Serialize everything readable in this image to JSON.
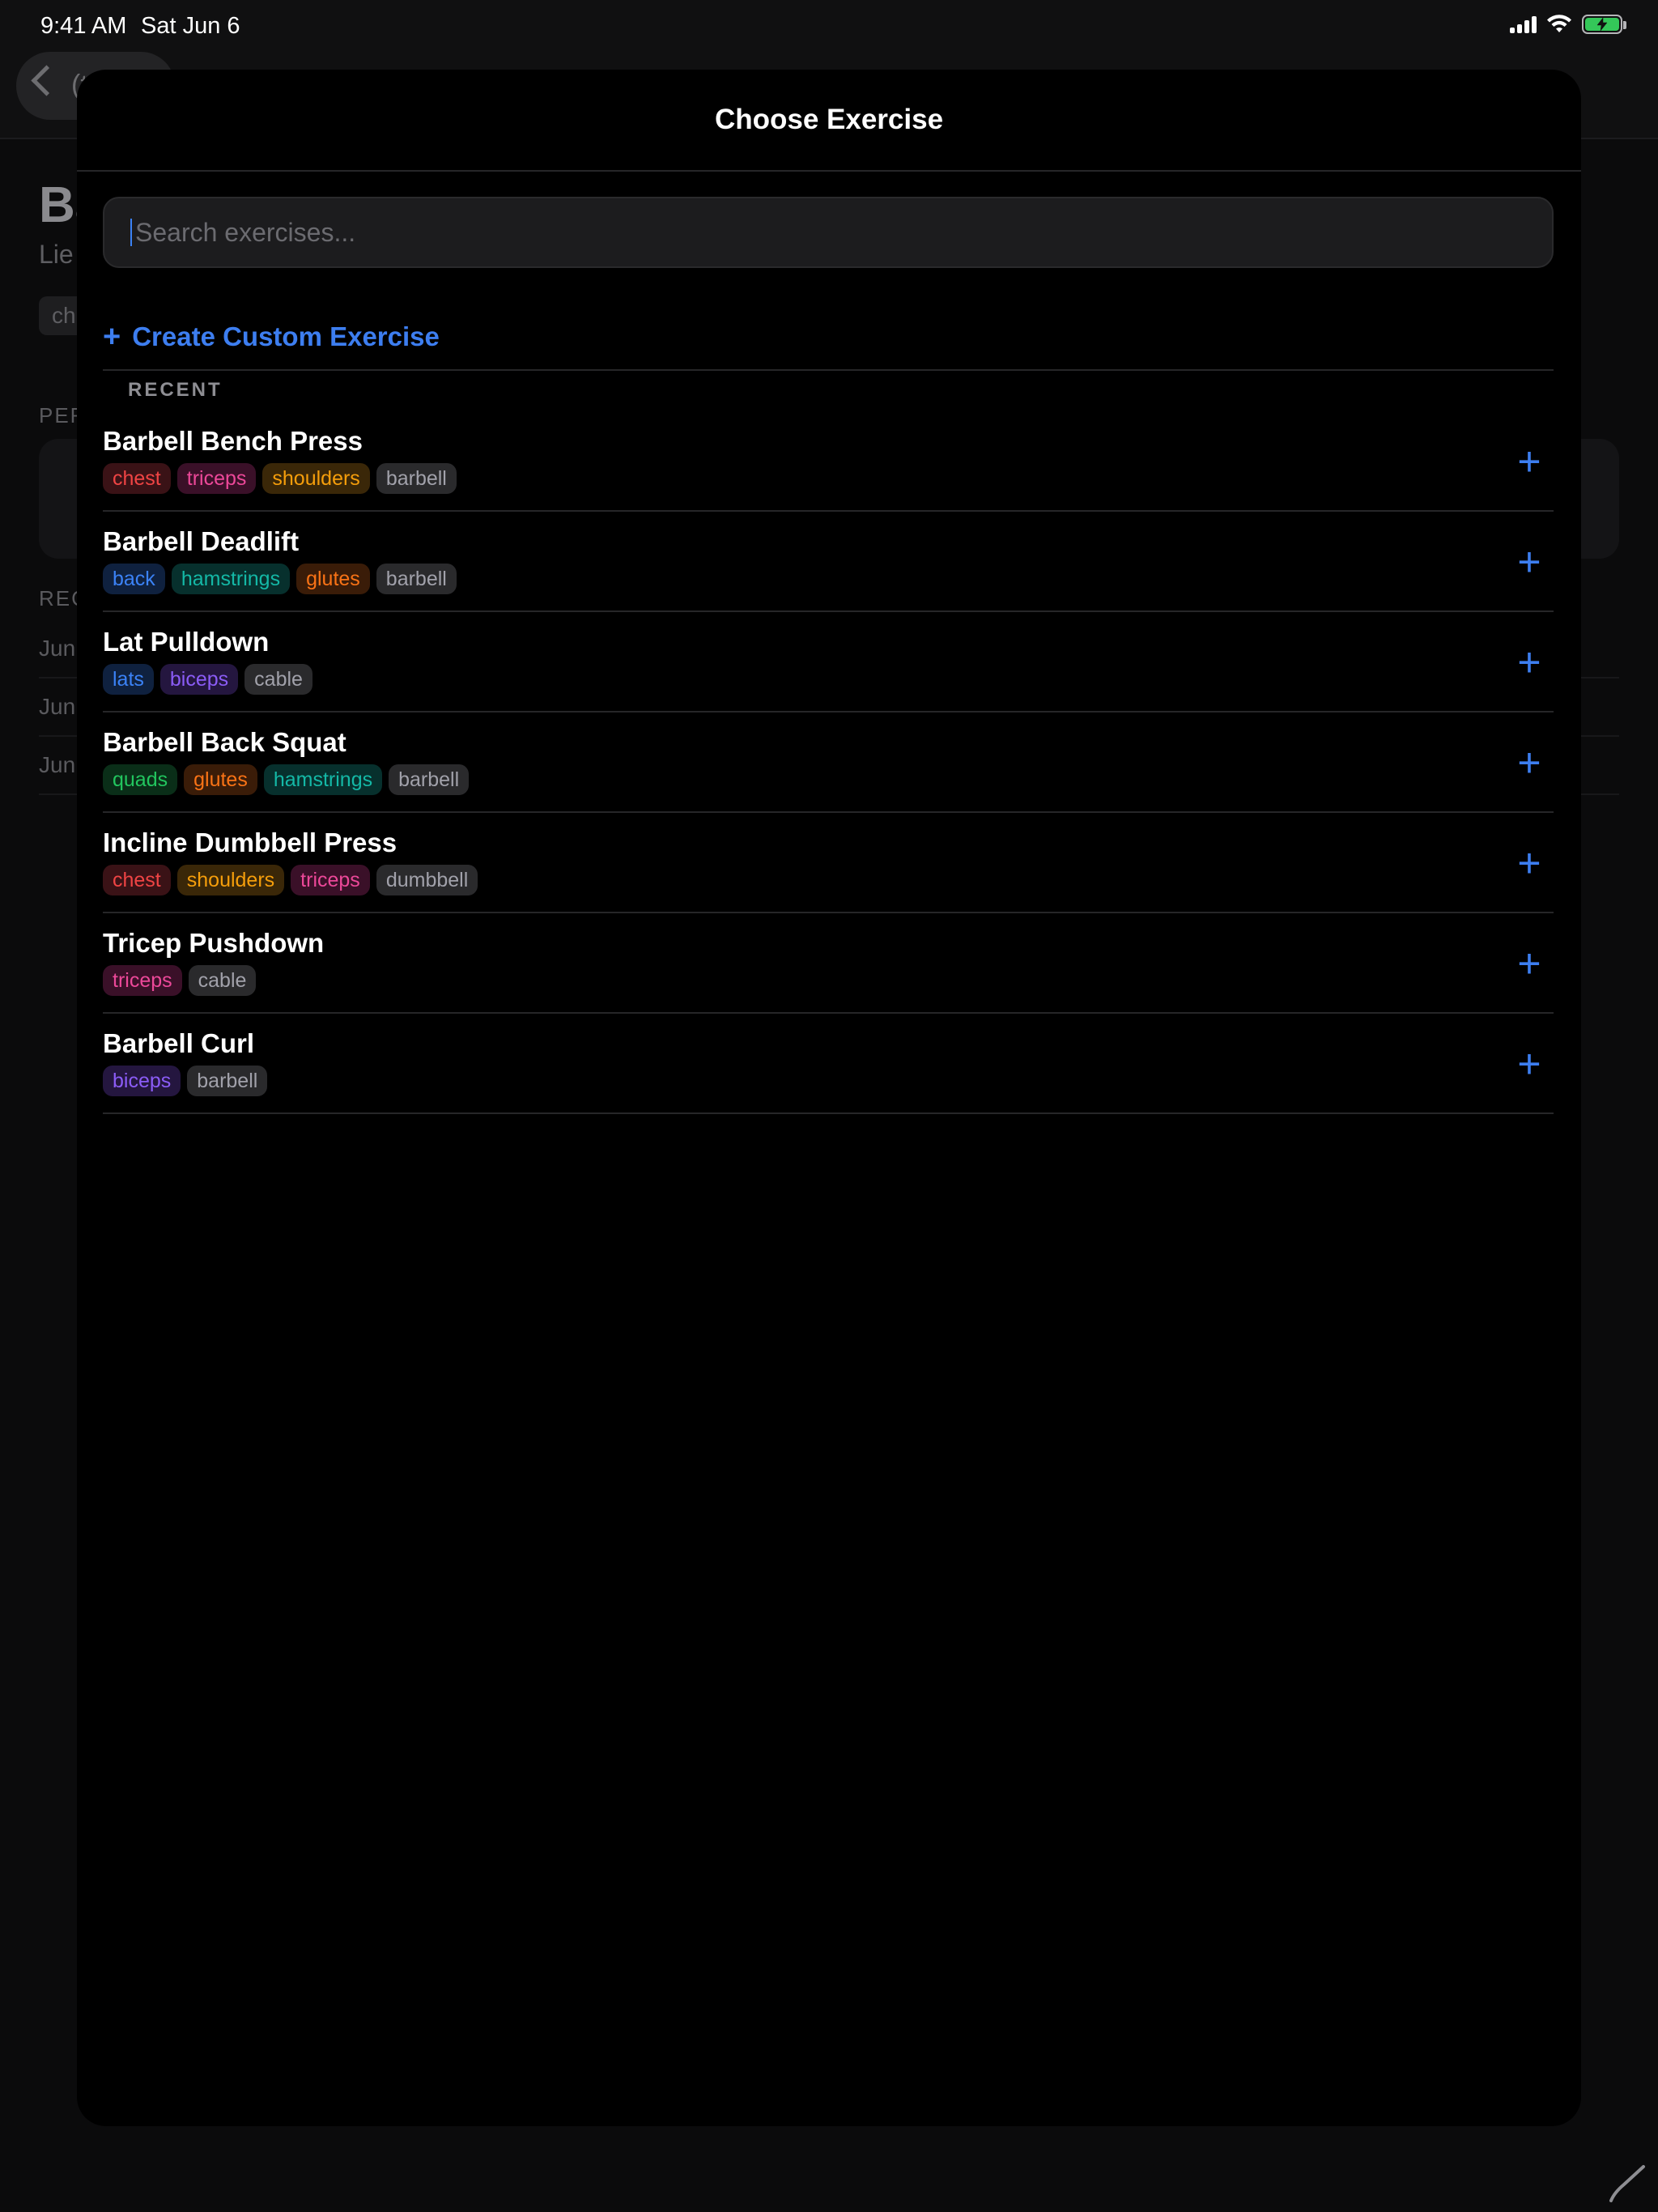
{
  "status_bar": {
    "time": "9:41 AM",
    "date": "Sat Jun 6"
  },
  "background": {
    "back_label": "(t",
    "title": "Ba",
    "subtitle": "Lie",
    "chip": "ch",
    "section_personal": "PER",
    "section_recent": "REC",
    "rows": [
      "Jun",
      "Jun",
      "Jun"
    ]
  },
  "sheet": {
    "title": "Choose Exercise",
    "search": {
      "placeholder": "Search exercises...",
      "value": ""
    },
    "create_label": "Create Custom Exercise",
    "section_label": "RECENT",
    "exercises": [
      {
        "name": "Barbell Bench Press",
        "tags": [
          {
            "label": "chest",
            "color": "#ef4444",
            "bg": "#3a1216"
          },
          {
            "label": "triceps",
            "color": "#ec4899",
            "bg": "#3a1028"
          },
          {
            "label": "shoulders",
            "color": "#f59e0b",
            "bg": "#3a2708"
          },
          {
            "label": "barbell",
            "color": "#a1a1aa",
            "bg": "#2a2a2c"
          }
        ]
      },
      {
        "name": "Barbell Deadlift",
        "tags": [
          {
            "label": "back",
            "color": "#3b82f6",
            "bg": "#0f213f"
          },
          {
            "label": "hamstrings",
            "color": "#14b8a6",
            "bg": "#07302d"
          },
          {
            "label": "glutes",
            "color": "#f97316",
            "bg": "#3a1c08"
          },
          {
            "label": "barbell",
            "color": "#a1a1aa",
            "bg": "#2a2a2c"
          }
        ]
      },
      {
        "name": "Lat Pulldown",
        "tags": [
          {
            "label": "lats",
            "color": "#3b82f6",
            "bg": "#0f213f"
          },
          {
            "label": "biceps",
            "color": "#8b5cf6",
            "bg": "#24163f"
          },
          {
            "label": "cable",
            "color": "#a1a1aa",
            "bg": "#2a2a2c"
          }
        ]
      },
      {
        "name": "Barbell Back Squat",
        "tags": [
          {
            "label": "quads",
            "color": "#22c55e",
            "bg": "#0a2e18"
          },
          {
            "label": "glutes",
            "color": "#f97316",
            "bg": "#3a1c08"
          },
          {
            "label": "hamstrings",
            "color": "#14b8a6",
            "bg": "#07302d"
          },
          {
            "label": "barbell",
            "color": "#a1a1aa",
            "bg": "#2a2a2c"
          }
        ]
      },
      {
        "name": "Incline Dumbbell Press",
        "tags": [
          {
            "label": "chest",
            "color": "#ef4444",
            "bg": "#3a1216"
          },
          {
            "label": "shoulders",
            "color": "#f59e0b",
            "bg": "#3a2708"
          },
          {
            "label": "triceps",
            "color": "#ec4899",
            "bg": "#3a1028"
          },
          {
            "label": "dumbbell",
            "color": "#a1a1aa",
            "bg": "#2a2a2c"
          }
        ]
      },
      {
        "name": "Tricep Pushdown",
        "tags": [
          {
            "label": "triceps",
            "color": "#ec4899",
            "bg": "#3a1028"
          },
          {
            "label": "cable",
            "color": "#a1a1aa",
            "bg": "#2a2a2c"
          }
        ]
      },
      {
        "name": "Barbell Curl",
        "tags": [
          {
            "label": "biceps",
            "color": "#8b5cf6",
            "bg": "#24163f"
          },
          {
            "label": "barbell",
            "color": "#a1a1aa",
            "bg": "#2a2a2c"
          }
        ]
      }
    ]
  },
  "colors": {
    "accent": "#3d7ef0",
    "background": "#000000",
    "battery_fill": "#34c759"
  },
  "icons": {
    "back": "chevron-left-icon",
    "create": "plus-icon",
    "add": "plus-icon",
    "signal": "cellular-signal-icon",
    "wifi": "wifi-icon",
    "battery": "battery-charging-icon",
    "pencil": "pencil-hover-icon"
  }
}
